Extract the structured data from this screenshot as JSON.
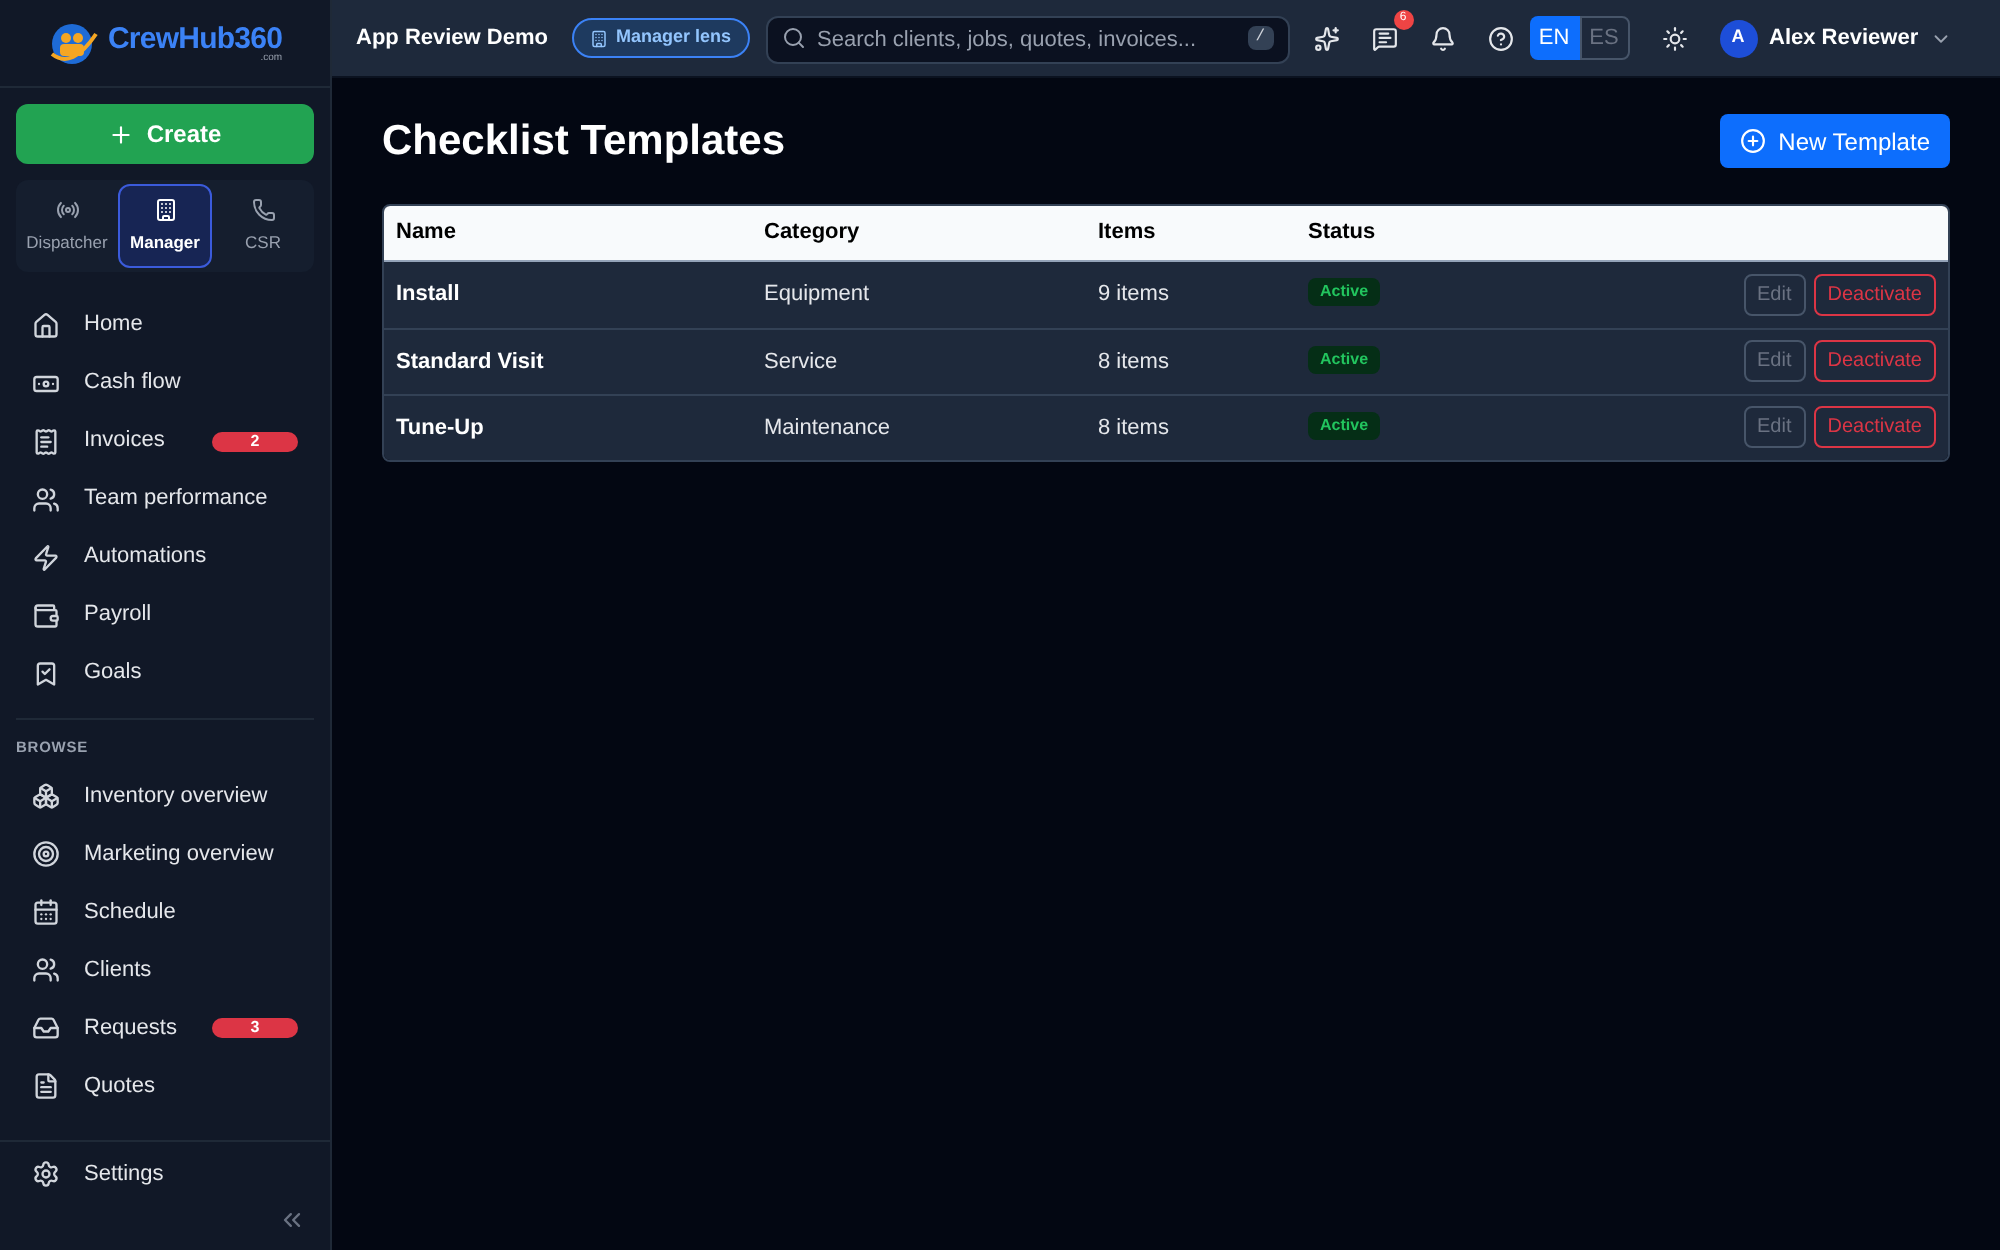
{
  "logo": {
    "name": "CrewHub360",
    "suffix": ".com"
  },
  "create_button": {
    "label": "Create"
  },
  "roles": [
    {
      "label": "Dispatcher",
      "kind": "signal",
      "selected": false
    },
    {
      "label": "Manager",
      "kind": "building",
      "selected": true
    },
    {
      "label": "CSR",
      "kind": "phone",
      "selected": false
    }
  ],
  "nav": [
    {
      "label": "Home",
      "kind": "home"
    },
    {
      "label": "Cash flow",
      "kind": "cash"
    },
    {
      "label": "Invoices",
      "kind": "invoice",
      "badge": "2"
    },
    {
      "label": "Team performance",
      "kind": "users"
    },
    {
      "label": "Automations",
      "kind": "bolt"
    },
    {
      "label": "Payroll",
      "kind": "payroll"
    },
    {
      "label": "Goals",
      "kind": "bookmark"
    }
  ],
  "browse": {
    "heading": "BROWSE",
    "items": [
      {
        "label": "Inventory overview",
        "kind": "boxes"
      },
      {
        "label": "Marketing overview",
        "kind": "target"
      },
      {
        "label": "Schedule",
        "kind": "calendar"
      },
      {
        "label": "Clients",
        "kind": "users"
      },
      {
        "label": "Requests",
        "kind": "inbox",
        "badge": "3"
      },
      {
        "label": "Quotes",
        "kind": "file"
      }
    ]
  },
  "settings": {
    "label": "Settings"
  },
  "topbar": {
    "workspace": "App Review Demo",
    "lens": "Manager lens",
    "search": {
      "placeholder": "Search clients, jobs, quotes, invoices...",
      "shortcut": "/"
    },
    "messages_badge": "6",
    "languages": [
      {
        "label": "EN",
        "selected": true
      },
      {
        "label": "ES",
        "selected": false
      }
    ],
    "user": {
      "initial": "A",
      "name": "Alex Reviewer"
    }
  },
  "page": {
    "title": "Checklist Templates",
    "new_button": "New Template"
  },
  "table": {
    "columns": [
      "Name",
      "Category",
      "Items",
      "Status"
    ],
    "rows": [
      {
        "name": "Install",
        "category": "Equipment",
        "items": "9 items",
        "status": "Active",
        "edit": "Edit",
        "deactivate": "Deactivate"
      },
      {
        "name": "Standard Visit",
        "category": "Service",
        "items": "8 items",
        "status": "Active",
        "edit": "Edit",
        "deactivate": "Deactivate"
      },
      {
        "name": "Tune-Up",
        "category": "Maintenance",
        "items": "8 items",
        "status": "Active",
        "edit": "Edit",
        "deactivate": "Deactivate"
      }
    ]
  }
}
